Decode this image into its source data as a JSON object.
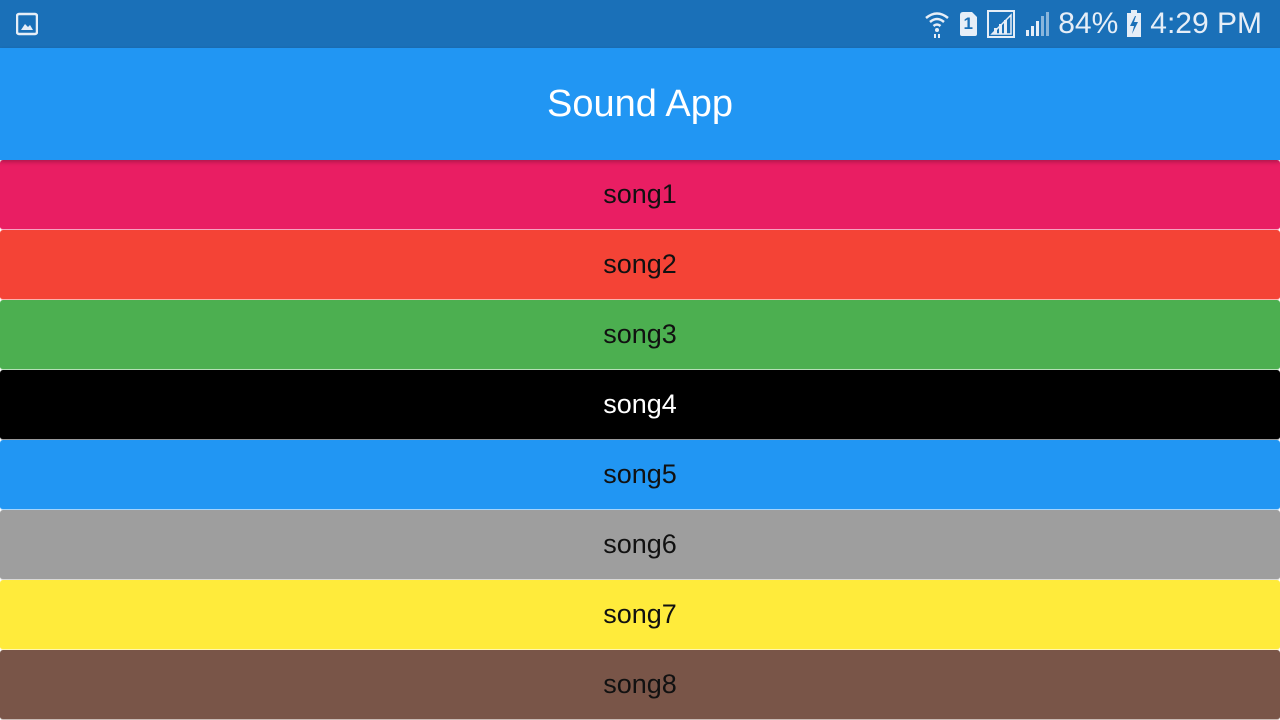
{
  "status_bar": {
    "battery_percent": "84%",
    "time": "4:29 PM",
    "sim_slot": "1",
    "icons": [
      "image-icon",
      "wifi-icon",
      "sim-icon",
      "signal-icon",
      "signal-icon",
      "battery-charging-icon"
    ]
  },
  "app_bar": {
    "title": "Sound App",
    "color": "#2196f3"
  },
  "songs": [
    {
      "label": "song1",
      "color": "#e91e63",
      "text_color": "#111111"
    },
    {
      "label": "song2",
      "color": "#f44336",
      "text_color": "#111111"
    },
    {
      "label": "song3",
      "color": "#4caf50",
      "text_color": "#111111"
    },
    {
      "label": "song4",
      "color": "#000000",
      "text_color": "#ffffff"
    },
    {
      "label": "song5",
      "color": "#2196f3",
      "text_color": "#111111"
    },
    {
      "label": "song6",
      "color": "#9e9e9e",
      "text_color": "#111111"
    },
    {
      "label": "song7",
      "color": "#ffeb3b",
      "text_color": "#111111"
    },
    {
      "label": "song8",
      "color": "#795548",
      "text_color": "#111111"
    }
  ]
}
